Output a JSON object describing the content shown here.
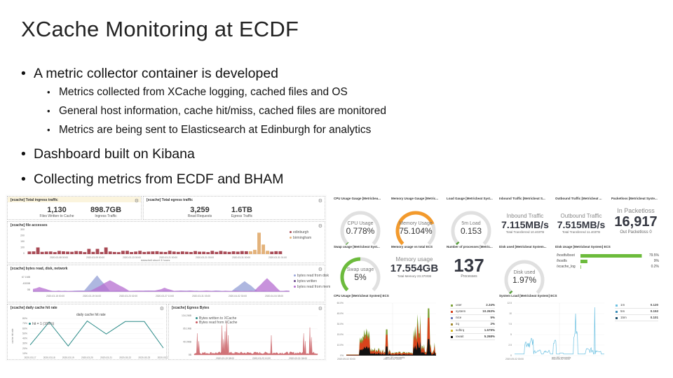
{
  "slide": {
    "title": "XCache Monitoring  at  ECDF",
    "bullets": [
      {
        "text": "A  metric  collector  container  is  developed",
        "sub": [
          "Metrics collected from XCache logging, cached files and OS",
          "General host information, cache hit/miss, cached  files  are monitored",
          "Metrics  are  being  sent  to  Elasticsearch at  Edinburgh for analytics"
        ]
      },
      {
        "text": "Dashboard built on Kibana",
        "sub": []
      },
      {
        "text": "Collecting  metrics  from  ECDF  and  BHAM",
        "sub": []
      }
    ]
  },
  "kibana": {
    "ingress_panel": {
      "title": "[ecache] Total ingress traffic",
      "metrics": [
        {
          "value": "1,130",
          "label": "Files Written to Cache"
        },
        {
          "value": "898.7GB",
          "label": "Ingress Traffic"
        }
      ]
    },
    "egress_panel": {
      "title": "[xcache] Total egress traffic",
      "metrics": [
        {
          "value": "3,259",
          "label": "Read Requests"
        },
        {
          "value": "1.6TB",
          "label": "Egress Traffic"
        }
      ]
    },
    "file_requests_panel": {
      "title": "[xcache] file accesses",
      "ylabel": "Count",
      "xlabel": "datachell.stsort 3 hours",
      "yticks": [
        "300",
        "200",
        "150",
        "100",
        "0"
      ],
      "xticks": [
        "2020-03-08 00:00",
        "2020-03-09 00:00",
        "2020-03-13 00:00",
        "2020-03-21 00:00",
        "2020-03-21 03:00",
        "2020-03-31 00:00",
        "2020-03-31 01:00"
      ],
      "legend": [
        {
          "name": "edinburgh",
          "color": "#a84a55"
        },
        {
          "name": "birmingham",
          "color": "#e3b27a"
        }
      ]
    },
    "bytes_panel": {
      "title": "[xcache] bytes read, disk, network",
      "ylabel": "bytes",
      "yticks": [
        "67.1MB",
        "-6300B",
        "0B"
      ],
      "xticks": [
        "2020-03-15 00:00",
        "2020-03-19 04:00",
        "2020-03-23 02:00",
        "2020-03-27 10:00",
        "2020-03-31 03:00",
        "2020-04-02 30:00",
        "2020-04-04 08:00"
      ],
      "legend": [
        {
          "name": "bytes read from disk",
          "color": "#9aa5d8"
        },
        {
          "name": "bytes written",
          "color": "#6a4a8c"
        },
        {
          "name": "bytes read from mem",
          "color": "#b56ed0"
        }
      ]
    },
    "hit_rate_panel": {
      "title": "[xcache] daily cache hit rate",
      "chart_title": "daily cache hit rate",
      "ylabel": "cache hit rate",
      "legend_label": "hit = 1 (100%)",
      "yticks": [
        "80%",
        "70%",
        "60%",
        "50%",
        "40%",
        "30%",
        "20%",
        "10%"
      ],
      "xticks": [
        "2020-03-17",
        "2020-03-18",
        "2020-03-19",
        "2020-03-20",
        "2020-03-21",
        "2020-03-22",
        "2020-03-23",
        "2020-03-24"
      ]
    },
    "egress_bytes_panel": {
      "title": "[xcache] Egress Bytes",
      "ylabel": "bytes",
      "yticks": [
        "134.2MB",
        "95.1MB",
        "40.0MB",
        "0B"
      ],
      "xticks": [
        "2020-03-19 08:00",
        "2020-03-23 12:00",
        "2020-03-31 06:00"
      ],
      "legend": [
        {
          "name": "Bytes written to XCache",
          "color": "#2a8a87"
        },
        {
          "name": "Bytes read from XCache",
          "color": "#c85a60"
        }
      ]
    },
    "cpu_gauge": {
      "title": "CPU Usage Gauge [Metricbea...",
      "label": "CPU Usage",
      "value": "0.778%",
      "fraction": 0.00778
    },
    "mem_gauge": {
      "title": "Memory Usage Gauge [Metric...",
      "label": "Memory Usage",
      "value": "75.104%",
      "fraction": 0.75104
    },
    "load_gauge": {
      "title": "Load Gauge [Metricbeat Syst...",
      "label": "5m Load",
      "value": "0.153",
      "fraction": 0.02
    },
    "inbound": {
      "title": "Inbound Traffic [Metricbeat S...",
      "label": "Inbound Traffic",
      "value": "7.115MB/s",
      "sub": "Total Transferred 10.403TB"
    },
    "outbound": {
      "title": "Outbound Traffic [Metricbeat ...",
      "label": "Outbound Traffic",
      "value": "7.515MB/s",
      "sub": "Total Transferred 11.403TB"
    },
    "packetloss": {
      "title": "Packetloss [Metricbeat Syste...",
      "label": "In Packetloss",
      "value": "16,917",
      "sub": "Out Packetloss 0"
    },
    "swap_gauge": {
      "title": "Swap usage [Metricbeat Syst...",
      "label": "Swap usage",
      "value": "5%",
      "fraction": 0.05
    },
    "memory_total": {
      "title": "Memory usage vs total ECS",
      "label": "Memory usage",
      "value": "17.554GB",
      "sub": "Total Memory 23.370GB"
    },
    "processes": {
      "title": "Number of processes [Metric...",
      "value": "137",
      "label": "Processes"
    },
    "disk_gauge": {
      "title": "Disk used [Metricbeat System...",
      "label": "Disk used",
      "value": "1.97%",
      "fraction": 0.0197
    },
    "disk_usage": {
      "title": "Disk Usage [Metricbeat System] ECS",
      "rows": [
        {
          "mount": "/hostfs/boot",
          "value": "79.5%",
          "fraction": 0.795
        },
        {
          "mount": "/hostfs",
          "value": "9%",
          "fraction": 0.09
        },
        {
          "mount": "/xcache_log",
          "value": "0.2%",
          "fraction": 0.002
        }
      ]
    },
    "cpu_usage": {
      "title": "CPU Usage [Metricbeat System] ECS",
      "yticks": [
        "60.0%",
        "45.0%",
        "30.0%",
        "15.0%",
        "10.0%",
        "0%"
      ],
      "xticks": [
        "2019-09-02 00:00",
        "2019-09-02 03:00"
      ],
      "xlabel": "per 30 seconds",
      "legend": [
        {
          "name": "user",
          "value": "2.34%",
          "color": "#7fa33a"
        },
        {
          "name": "system",
          "value": "10.263%",
          "color": "#d8431c"
        },
        {
          "name": "nice",
          "value": "5%",
          "color": "#6b78b5"
        },
        {
          "name": "irq",
          "value": "2%",
          "color": "#a2892f"
        },
        {
          "name": "softirq",
          "value": "1.579%",
          "color": "#d6b82a"
        },
        {
          "name": "iowait",
          "value": "5.268%",
          "color": "#111111"
        }
      ]
    },
    "system_load": {
      "title": "System Load [Metricbeat System] ECS",
      "yticks": [
        "12.5",
        "10",
        "7.5",
        "5",
        "2.5",
        "0"
      ],
      "xticks": [
        "2019-09-02 00:00",
        "2019-09-02 03:00"
      ],
      "xlabel": "per 60 seconds",
      "legend": [
        {
          "name": "1m",
          "value": "0.120",
          "color": "#6fc2e2"
        },
        {
          "name": "5m",
          "value": "0.153",
          "color": "#3c8fbb"
        },
        {
          "name": "15m",
          "value": "0.101",
          "color": "#1b4d68"
        }
      ]
    }
  }
}
